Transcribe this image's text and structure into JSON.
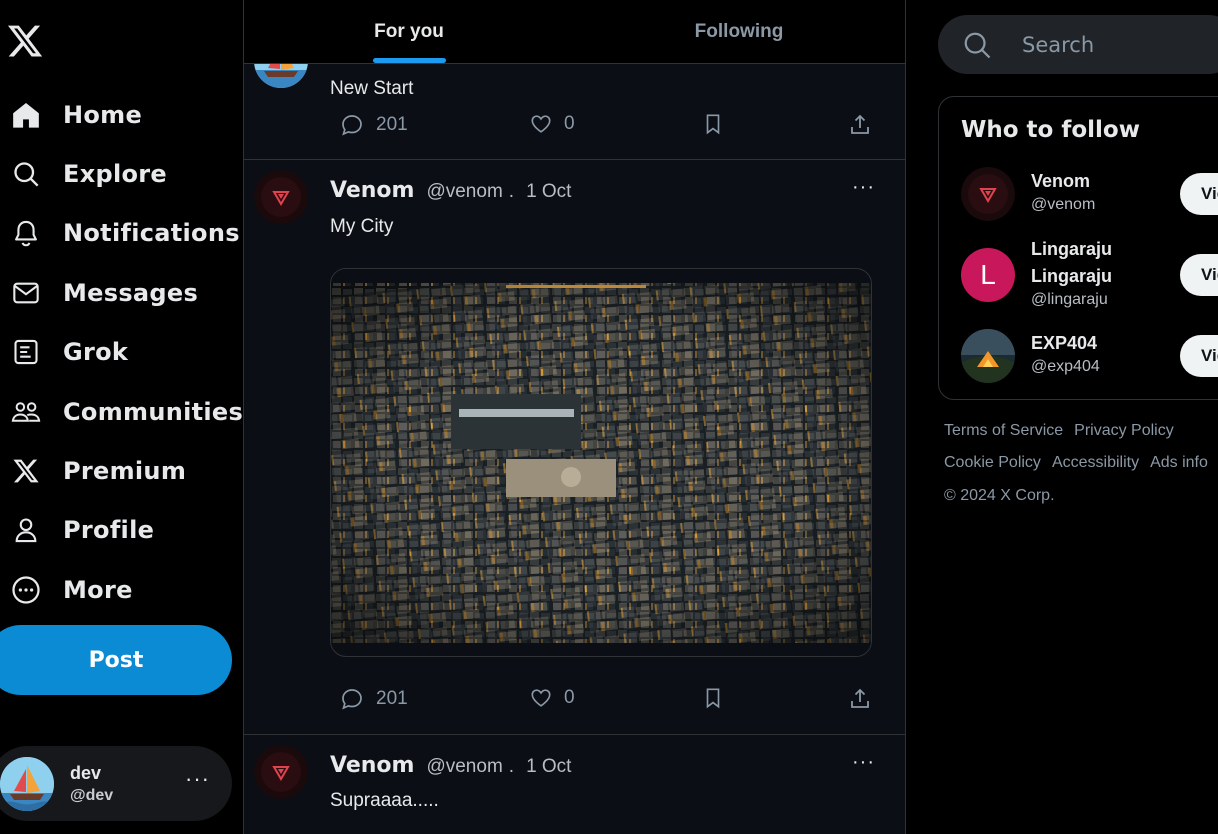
{
  "sidebar": {
    "logo": "x-logo-icon",
    "nav": [
      {
        "label": "Home",
        "icon": "home-icon"
      },
      {
        "label": "Explore",
        "icon": "search-icon"
      },
      {
        "label": "Notifications",
        "icon": "bell-icon"
      },
      {
        "label": "Messages",
        "icon": "mail-icon"
      },
      {
        "label": "Grok",
        "icon": "grok-icon"
      },
      {
        "label": "Communities",
        "icon": "communities-icon"
      },
      {
        "label": "Premium",
        "icon": "x-premium-icon"
      },
      {
        "label": "Profile",
        "icon": "person-icon"
      },
      {
        "label": "More",
        "icon": "more-circle-icon"
      }
    ],
    "post_label": "Post",
    "account": {
      "name": "dev",
      "handle": "@dev",
      "more": "···"
    }
  },
  "tabs": [
    {
      "label": "For you",
      "active": true
    },
    {
      "label": "Following",
      "active": false
    }
  ],
  "feed": [
    {
      "text": "New Start",
      "replies": "201",
      "likes": "0"
    },
    {
      "name": "Venom",
      "handle": "@venom",
      "sep": ".",
      "date": "1 Oct",
      "text": "My City",
      "media": "aerial-city-photo",
      "replies": "201",
      "likes": "0"
    },
    {
      "name": "Venom",
      "handle": "@venom",
      "sep": ".",
      "date": "1 Oct",
      "text": "Supraaaa....."
    }
  ],
  "right": {
    "search_placeholder": "Search",
    "who_to_follow": {
      "title": "Who to follow",
      "users": [
        {
          "name": "Venom",
          "handle": "@venom",
          "button": "View"
        },
        {
          "name": "Lingaraju Lingaraju",
          "name_line1": "Lingaraju",
          "name_line2": "Lingaraju",
          "handle": "@lingaraju",
          "avatar_letter": "L",
          "button": "View"
        },
        {
          "name": "EXP404",
          "handle": "@exp404",
          "button": "View"
        }
      ]
    },
    "footer": {
      "links": [
        "Terms of Service",
        "Privacy Policy",
        "Cookie Policy",
        "Accessibility",
        "Ads info"
      ],
      "copyright": "© 2024 X Corp."
    }
  },
  "colors": {
    "accent": "#1d9bf0",
    "post_button": "#0a8bd4",
    "background": "#000000",
    "feed_bg": "#0b0e14",
    "lingaraju_avatar": "#c8175b"
  }
}
